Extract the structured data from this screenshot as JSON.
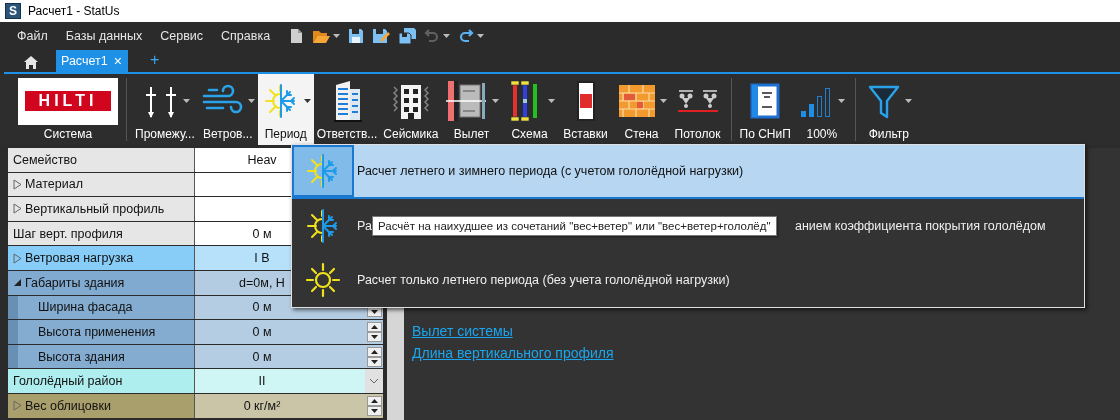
{
  "window": {
    "icon_text": "S",
    "title": "Расчет1 - StatUs"
  },
  "menu": [
    "Файл",
    "Базы данных",
    "Сервис",
    "Справка"
  ],
  "toolbar": [
    {
      "dropdown": false,
      "disabled": false
    },
    {
      "dropdown": true,
      "disabled": false
    },
    {
      "dropdown": false,
      "disabled": false
    },
    {
      "dropdown": false,
      "disabled": false
    },
    {
      "dropdown": false,
      "disabled": false
    },
    {
      "dropdown": true,
      "disabled": true
    },
    {
      "dropdown": true,
      "disabled": false
    }
  ],
  "tabs": [
    {
      "label": "Расчет1",
      "close": "×",
      "selected": true
    }
  ],
  "new_tab": "+",
  "ribbon": [
    [
      {
        "label": "Система",
        "logo_text": "HILTI",
        "dropdown": false,
        "selected": false
      }
    ],
    [
      {
        "label": "Промежу...",
        "dropdown": true,
        "selected": false
      },
      {
        "label": "Ветров...",
        "dropdown": true,
        "selected": false
      },
      {
        "label": "Период",
        "dropdown": true,
        "selected": true
      },
      {
        "label": "Ответств...",
        "dropdown": false,
        "selected": false
      },
      {
        "label": "Сейсмика",
        "dropdown": false,
        "selected": false
      },
      {
        "label": "Вылет",
        "dropdown": true,
        "selected": false
      },
      {
        "label": "Схема",
        "dropdown": true,
        "selected": false
      },
      {
        "label": "Вставки",
        "dropdown": false,
        "selected": false
      },
      {
        "label": "Стена",
        "dropdown": true,
        "selected": false
      },
      {
        "label": "Потолок",
        "dropdown": false,
        "selected": false
      }
    ],
    [
      {
        "label": "По СНиП",
        "dropdown": false,
        "selected": false
      },
      {
        "label": "100%",
        "dropdown": true,
        "selected": false
      }
    ],
    [
      {
        "label": "Фильтр",
        "dropdown": true,
        "selected": false
      }
    ]
  ],
  "grid": [
    {
      "label": "Семейство",
      "value": "Heav",
      "color": "#e6e6e6",
      "kind": "none"
    },
    {
      "label": "Материал",
      "color": "#e6e6e6",
      "kind": "none",
      "expanded": false
    },
    {
      "label": "Вертикальный профиль",
      "color": "#e6e6e6",
      "kind": "none",
      "expanded": false
    },
    {
      "label": "Шаг верт. профиля",
      "value": "0 м",
      "color": "#e6e6e6",
      "kind": "none"
    },
    {
      "label": "Ветровая нагрузка",
      "value": "I В",
      "color": "#87cdf8",
      "kind": "none",
      "expanded": false
    },
    {
      "label": "Габариты здания",
      "value": "d=0м, Н",
      "color": "#80aacf",
      "kind": "none",
      "expanded": true,
      "children": [
        {
          "label": "Ширина фасада",
          "value": "0 м",
          "color": "#84acd0",
          "kind": "spinner"
        },
        {
          "label": "Высота применения",
          "value": "0 м",
          "color": "#84acd0",
          "kind": "spinner"
        },
        {
          "label": "Высота здания",
          "value": "0 м",
          "color": "#84acd0",
          "kind": "spinner"
        }
      ]
    },
    {
      "label": "Гололёдный район",
      "value": "II",
      "color": "#afeeee",
      "kind": "dropdown"
    },
    {
      "label": "Вес облицовки",
      "value": "0 кг/м²",
      "color": "#a99f6c",
      "kind": "spinner",
      "expanded": false
    }
  ],
  "links": [
    "Вылет системы",
    "Длина вертикального профиля"
  ],
  "period_menu": [
    {
      "label_parts": [
        "Расчет летнего и зимнего периода (с учетом гололёдной нагрузки)"
      ],
      "selected": true
    },
    {
      "label_parts": [
        "Ра",
        "анием коэффициента покрытия гололёдом"
      ],
      "selected": false
    },
    {
      "label_parts": [
        "Расчет только летнего периода (без учета гололёдной нагрузки)"
      ],
      "selected": false
    }
  ],
  "tooltip": "Расчёт на наихудшее из сочетаний \"вес+ветер\" или \"вес+ветер+гололёд\""
}
